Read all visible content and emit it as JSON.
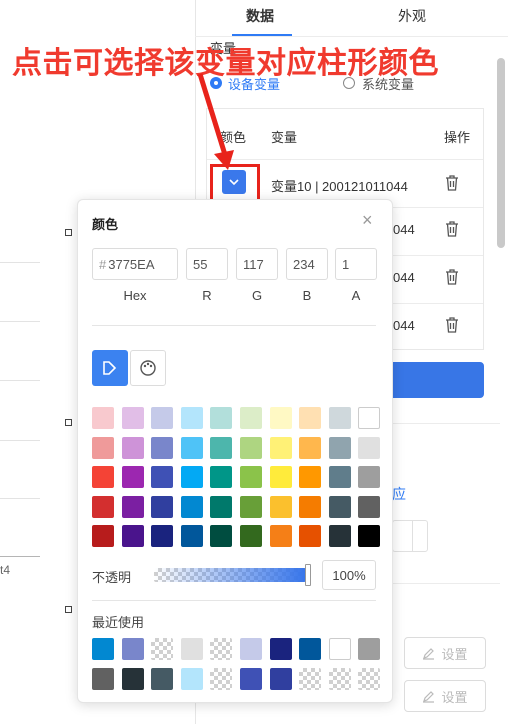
{
  "annotation": "点击可选择该变量对应柱形颜色",
  "tabs": [
    {
      "label": "数据"
    },
    {
      "label": "外观"
    }
  ],
  "section_label": "变量",
  "radio_options": [
    {
      "label": "设备变量",
      "selected": true
    },
    {
      "label": "系统变量",
      "selected": false
    }
  ],
  "table": {
    "headers": {
      "color": "颜色",
      "variable": "变量",
      "action": "操作"
    },
    "rows": [
      {
        "variable": "变量10 | 200121011044"
      },
      {
        "variable": "044"
      },
      {
        "variable": "044"
      },
      {
        "variable": "044"
      }
    ]
  },
  "partial_text": {
    "ying": "应",
    "axis_tick": "t4"
  },
  "settings_buttons": [
    {
      "label": "设置"
    },
    {
      "label": "设置"
    }
  ],
  "picker": {
    "title": "颜色",
    "close": "×",
    "hex_prefix": "#",
    "fields": [
      {
        "value": "3775EA",
        "label": "Hex"
      },
      {
        "value": "55",
        "label": "R"
      },
      {
        "value": "117",
        "label": "G"
      },
      {
        "value": "234",
        "label": "B"
      },
      {
        "value": "1",
        "label": "A"
      }
    ],
    "opacity_label": "不透明",
    "opacity_value": "100%",
    "recent_label": "最近使用",
    "current_color": "#3775EA",
    "palette": [
      [
        "#F8C9CE",
        "#E1BEE7",
        "#C5CAE9",
        "#B3E5FC",
        "#B2DFDB",
        "#DCEDC8",
        "#FFF9C4",
        "#FFE0B2",
        "#CFD8DC",
        "#FFFFFF"
      ],
      [
        "#EF9A9A",
        "#CE93D8",
        "#7986CB",
        "#4FC3F7",
        "#4DB6AC",
        "#AED581",
        "#FFF176",
        "#FFB74D",
        "#90A4AE",
        "#E0E0E0"
      ],
      [
        "#F44336",
        "#9C27B0",
        "#3F51B5",
        "#03A9F4",
        "#009688",
        "#8BC34A",
        "#FFEB3B",
        "#FF9800",
        "#607D8B",
        "#9E9E9E"
      ],
      [
        "#D32F2F",
        "#7B1FA2",
        "#303F9F",
        "#0288D1",
        "#00796B",
        "#689F38",
        "#FBC02D",
        "#F57C00",
        "#455A64",
        "#616161"
      ],
      [
        "#B71C1C",
        "#4A148C",
        "#1A237E",
        "#01579B",
        "#004D40",
        "#33691E",
        "#F57F17",
        "#E65100",
        "#263238",
        "#000000"
      ]
    ],
    "recent": [
      [
        "#0288D1",
        "#7986CB",
        "checker",
        "#E0E0E0",
        "checker",
        "#C5CAE9",
        "#1A237E",
        "#01579B",
        "#FFFFFF",
        "#9E9E9E"
      ],
      [
        "#616161",
        "#263238",
        "#455A64",
        "#B3E5FC",
        "checker",
        "#3F51B5",
        "#303F9F",
        "checker",
        "checker",
        "checker"
      ]
    ]
  }
}
